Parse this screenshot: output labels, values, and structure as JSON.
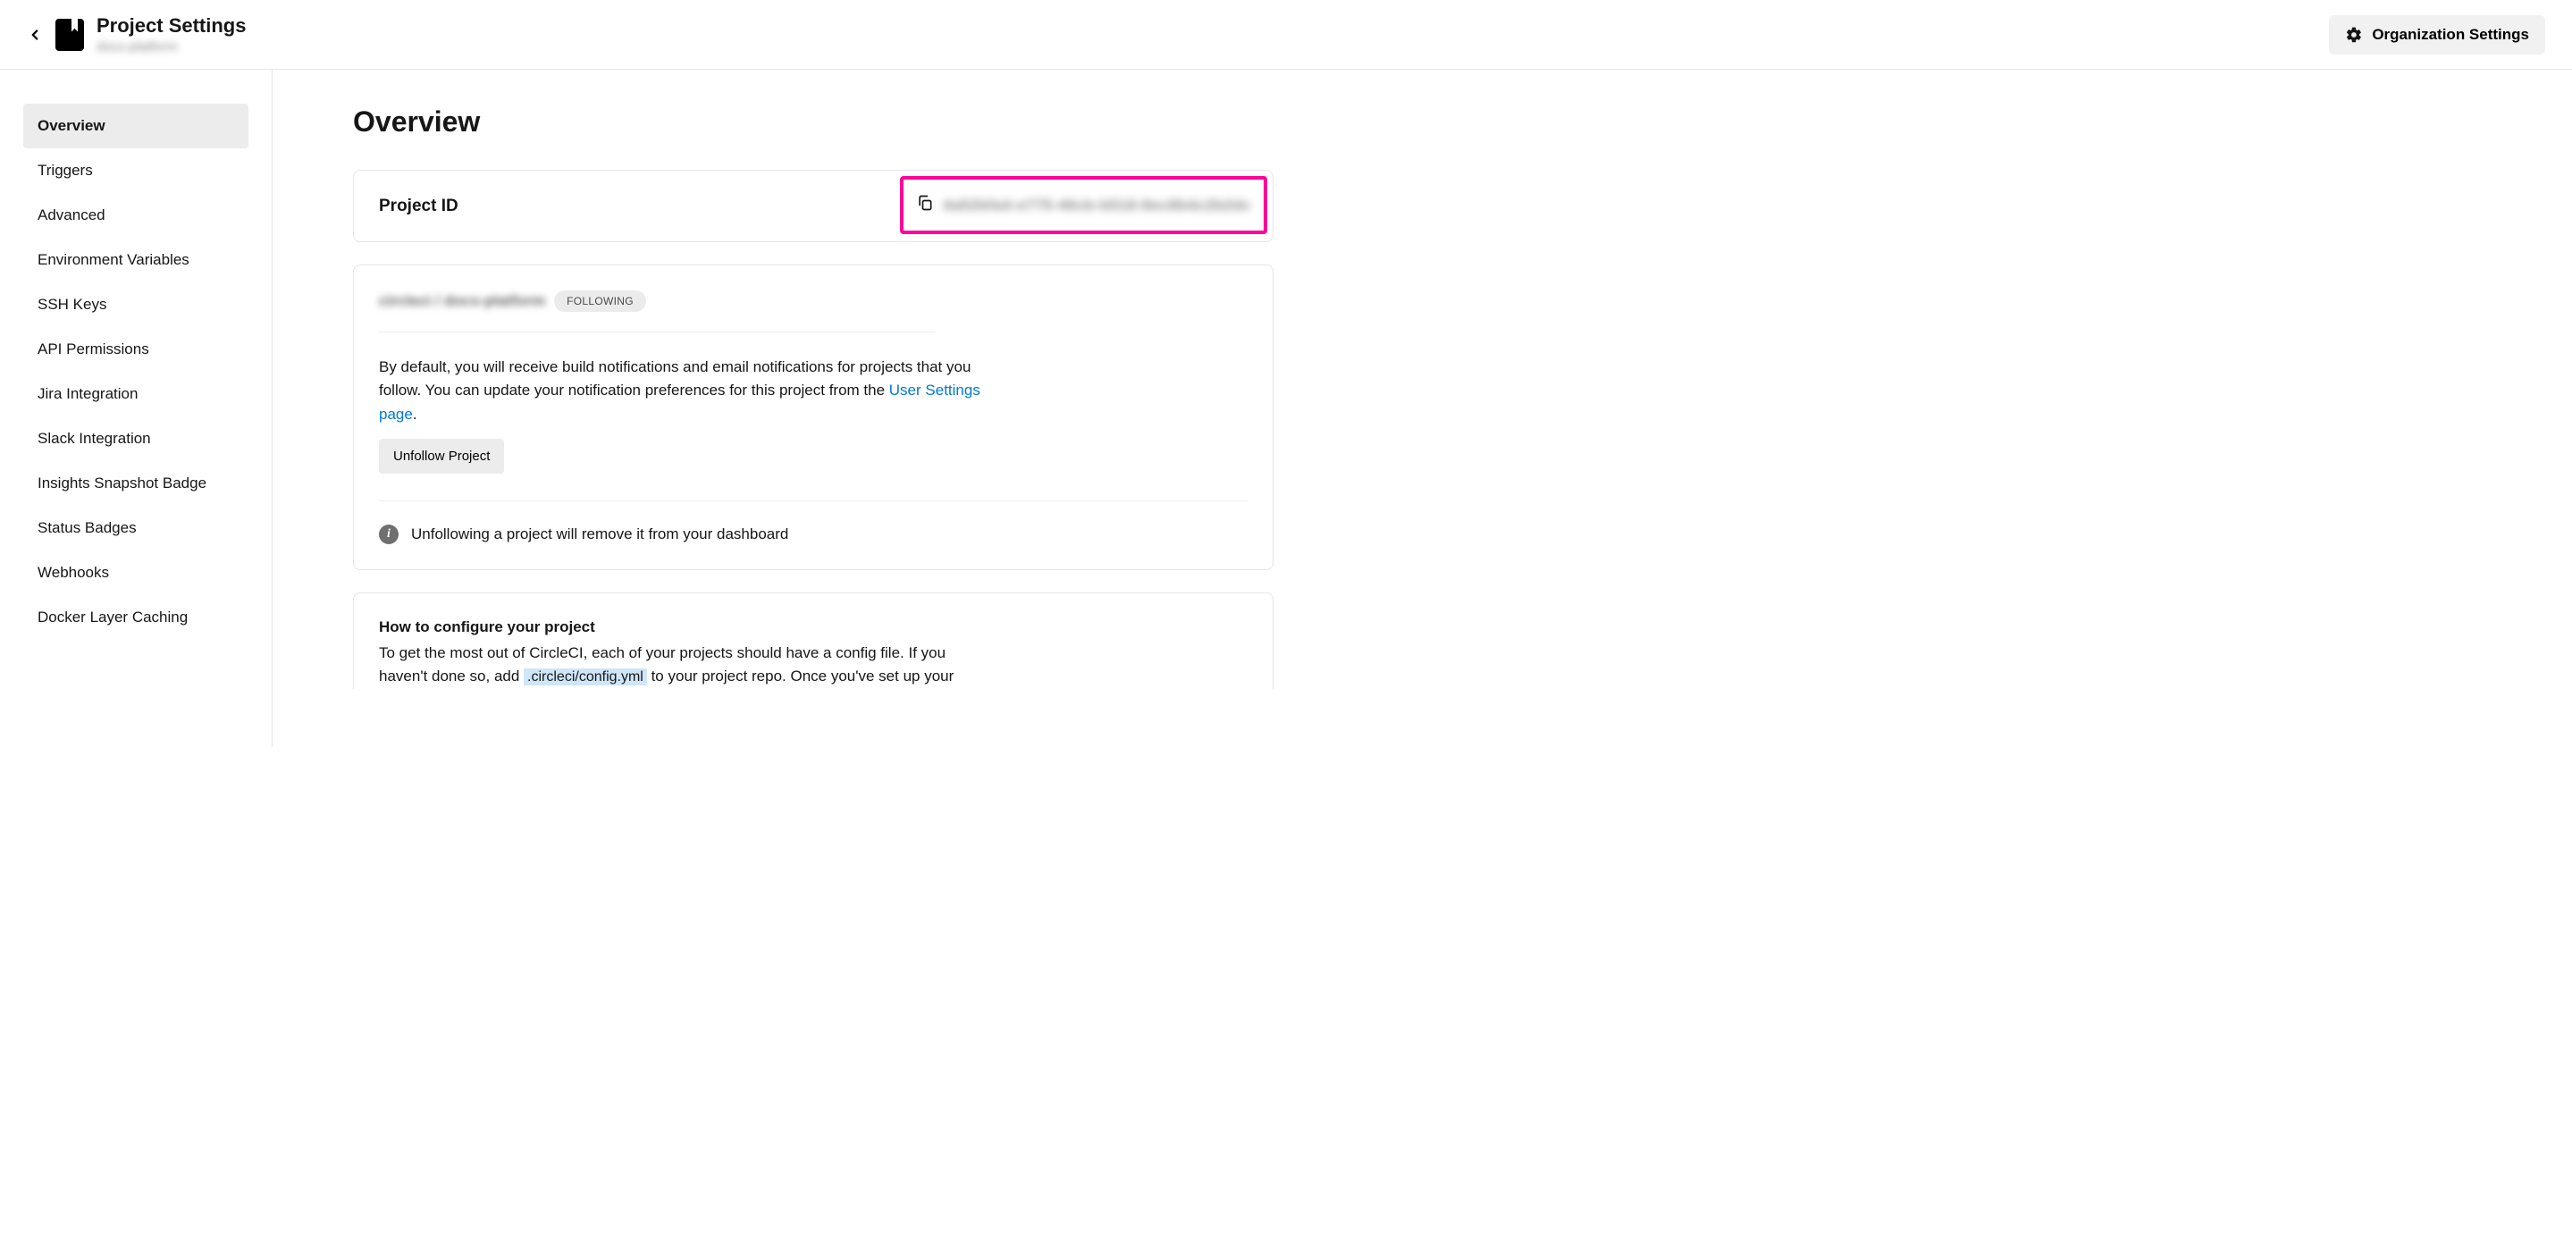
{
  "header": {
    "page_title": "Project Settings",
    "project_name": "docs-platform",
    "org_settings_label": "Organization Settings"
  },
  "sidebar": {
    "items": [
      {
        "label": "Overview",
        "active": true
      },
      {
        "label": "Triggers",
        "active": false
      },
      {
        "label": "Advanced",
        "active": false
      },
      {
        "label": "Environment Variables",
        "active": false
      },
      {
        "label": "SSH Keys",
        "active": false
      },
      {
        "label": "API Permissions",
        "active": false
      },
      {
        "label": "Jira Integration",
        "active": false
      },
      {
        "label": "Slack Integration",
        "active": false
      },
      {
        "label": "Insights Snapshot Badge",
        "active": false
      },
      {
        "label": "Status Badges",
        "active": false
      },
      {
        "label": "Webhooks",
        "active": false
      },
      {
        "label": "Docker Layer Caching",
        "active": false
      }
    ]
  },
  "main": {
    "heading": "Overview",
    "project_id_label": "Project ID",
    "project_id_value": "4a52bfa4-e775-46cb-b518-8ec8b4c2b2dc",
    "project_path": "circleci / docs-platform",
    "following_badge": "FOLLOWING",
    "notification_text_1": "By default, you will receive build notifications and email notifications for projects that you follow. You can update your notification preferences for this project from the ",
    "notification_link": "User Settings page",
    "notification_text_2": ".",
    "unfollow_label": "Unfollow Project",
    "info_text": "Unfollowing a project will remove it from your dashboard",
    "config_title": "How to configure your project",
    "config_text_1": "To get the most out of CircleCI, each of your projects should have a config file. If you haven't done so, add ",
    "config_code": ".circleci/config.yml",
    "config_text_2": " to your project repo. Once you've set up your"
  }
}
